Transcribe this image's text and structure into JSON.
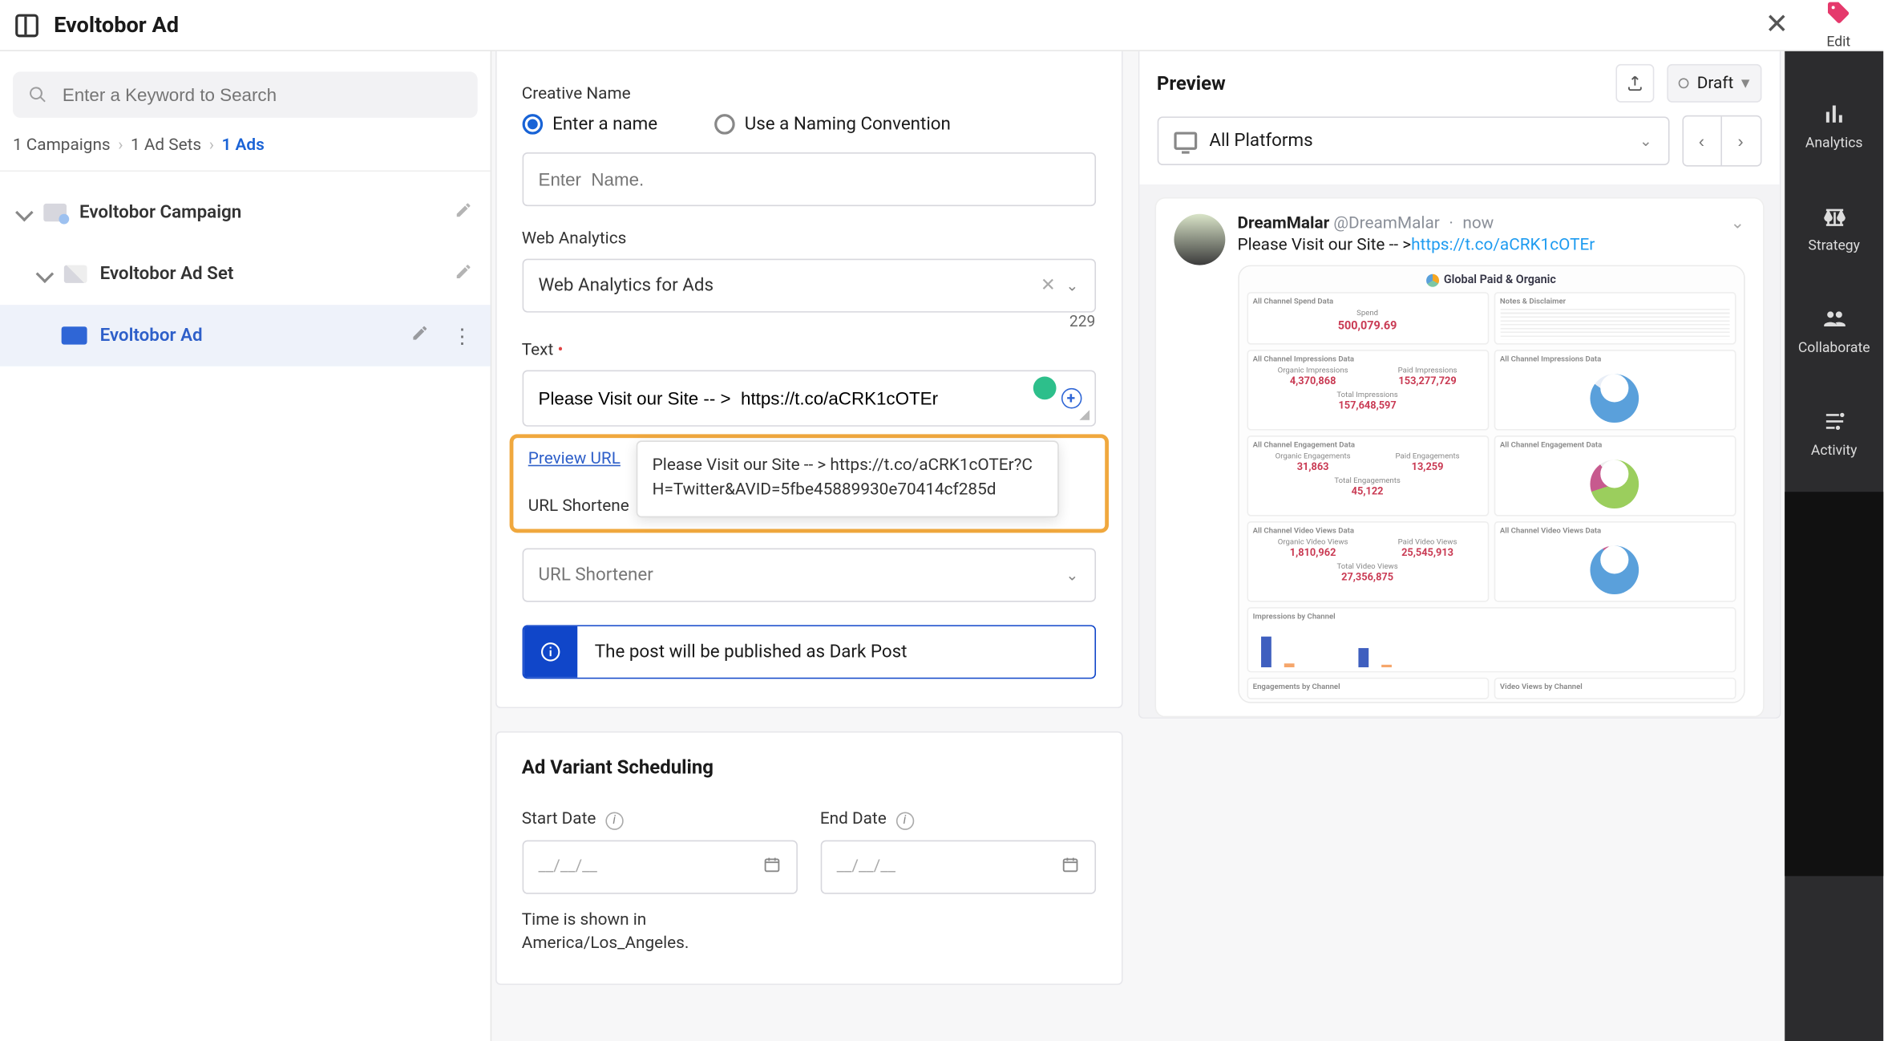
{
  "topbar": {
    "title": "Evoltobor Ad",
    "close_label": "Close",
    "edit_label": "Edit"
  },
  "sidebar": {
    "search_placeholder": "Enter a Keyword to Search",
    "crumb_campaigns": "1 Campaigns",
    "crumb_adsets": "1 Ad Sets",
    "crumb_ads": "1 Ads",
    "tree": {
      "campaign": "Evoltobor Campaign",
      "adset": "Evoltobor Ad Set",
      "ad": "Evoltobor Ad"
    }
  },
  "form": {
    "creative_name_label": "Creative Name",
    "radio_enter": "Enter a name",
    "radio_convention": "Use a Naming Convention",
    "name_placeholder": "Enter  Name.",
    "web_analytics_label": "Web Analytics",
    "web_analytics_value": "Web Analytics for Ads",
    "text_label": "Text",
    "text_count": "229",
    "text_value": "Please Visit our Site -- >  https://t.co/aCRK1cOTEr",
    "preview_url_label": "Preview URL",
    "tooltip_text": "Please Visit our Site -- > https://t.co/aCRK1cOTEr?CH=Twitter&AVID=5fbe45889930e70414cf285d",
    "url_shortener_label": "URL Shortene",
    "url_shortener_placeholder": "URL Shortener",
    "alert_text": "The post will be published as Dark Post",
    "scheduling_heading": "Ad Variant Scheduling",
    "start_date_label": "Start Date",
    "end_date_label": "End Date",
    "date_placeholder": "__/__/__",
    "tz_note": "Time is shown in America/Los_Angeles."
  },
  "preview": {
    "heading": "Preview",
    "status": "Draft",
    "platform_label": "All Platforms",
    "tweet": {
      "display_name": "DreamMalar",
      "handle": "@DreamMalar",
      "time": "now",
      "text_prefix": "Please Visit our Site -- >  ",
      "link_text": "https://t.co/aCRK1cOTEr"
    }
  },
  "dashboard": {
    "title": "Global Paid & Organic",
    "cards": {
      "spend_title": "All Channel Spend Data",
      "spend_label": "Spend",
      "spend_value": "500,079.69",
      "notes_title": "Notes & Disclaimer",
      "impr_title": "All Channel Impressions Data",
      "impr_org_label": "Organic Impressions",
      "impr_org_value": "4,370,868",
      "impr_paid_label": "Paid Impressions",
      "impr_paid_value": "153,277,729",
      "impr_total_label": "Total Impressions",
      "impr_total_value": "157,648,597",
      "impr_ring_title": "All Channel Impressions Data",
      "eng_title": "All Channel Engagement Data",
      "eng_org_label": "Organic Engagements",
      "eng_org_value": "31,863",
      "eng_paid_label": "Paid Engagements",
      "eng_paid_value": "13,259",
      "eng_total_label": "Total Engagements",
      "eng_total_value": "45,122",
      "eng_ring_title": "All Channel Engagement Data",
      "vid_title": "All Channel Video Views Data",
      "vid_org_label": "Organic Video Views",
      "vid_org_value": "1,810,962",
      "vid_paid_label": "Paid Video Views",
      "vid_paid_value": "25,545,913",
      "vid_total_label": "Total Video Views",
      "vid_total_value": "27,356,875",
      "vid_ring_title": "All Channel Video Views Data",
      "bar1_title": "Impressions by Channel",
      "bar2a_title": "Engagements by Channel",
      "bar2b_title": "Video Views by Channel"
    }
  },
  "rail": {
    "items": [
      "Analytics",
      "Strategy",
      "Collaborate",
      "Activity"
    ]
  }
}
